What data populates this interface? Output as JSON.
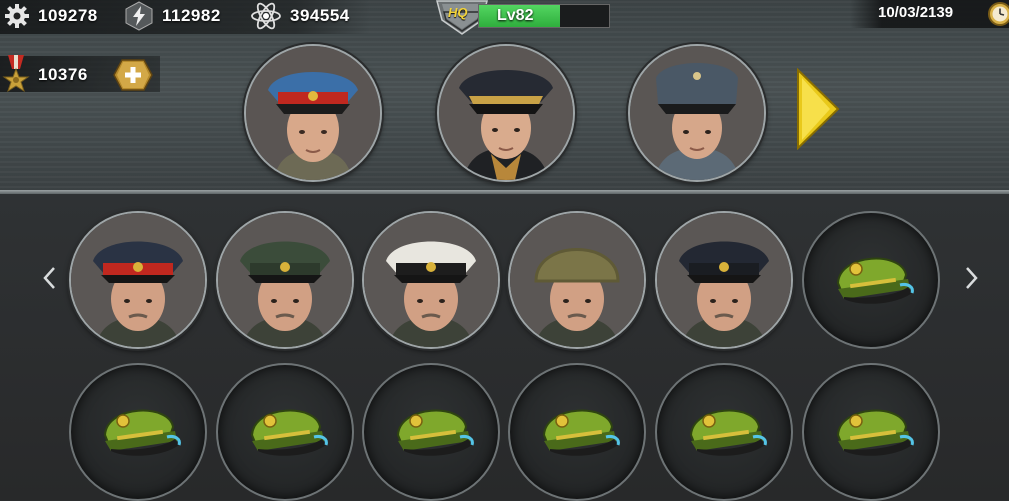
{
  "resources": {
    "gear": {
      "icon": "gear-icon",
      "value": "109278"
    },
    "energy": {
      "icon": "lightning-icon",
      "value": "112982"
    },
    "atom": {
      "icon": "atom-icon",
      "value": "394554"
    },
    "medal": {
      "icon": "medal-icon",
      "value": "10376"
    }
  },
  "hq": {
    "badge": "HQ",
    "level": "Lv82",
    "progress": 0.62
  },
  "date": "10/03/2139",
  "featured_generals": [
    {
      "name": "red-band-cap-general"
    },
    {
      "name": "navy-cap-general"
    },
    {
      "name": "field-cap-general"
    }
  ],
  "roster": {
    "row1": [
      {
        "type": "general",
        "hat": "red"
      },
      {
        "type": "general",
        "hat": "green"
      },
      {
        "type": "general",
        "hat": "white"
      },
      {
        "type": "general",
        "hat": "helmet"
      },
      {
        "type": "general",
        "hat": "navy"
      },
      {
        "type": "empty"
      }
    ],
    "row2": [
      {
        "type": "empty"
      },
      {
        "type": "empty"
      },
      {
        "type": "empty"
      },
      {
        "type": "empty"
      },
      {
        "type": "empty"
      },
      {
        "type": "empty"
      }
    ]
  },
  "colors": {
    "hq_bar": "#2fae3d",
    "arrow": "#f2d21b",
    "empty_cap": "#7fa82c"
  }
}
